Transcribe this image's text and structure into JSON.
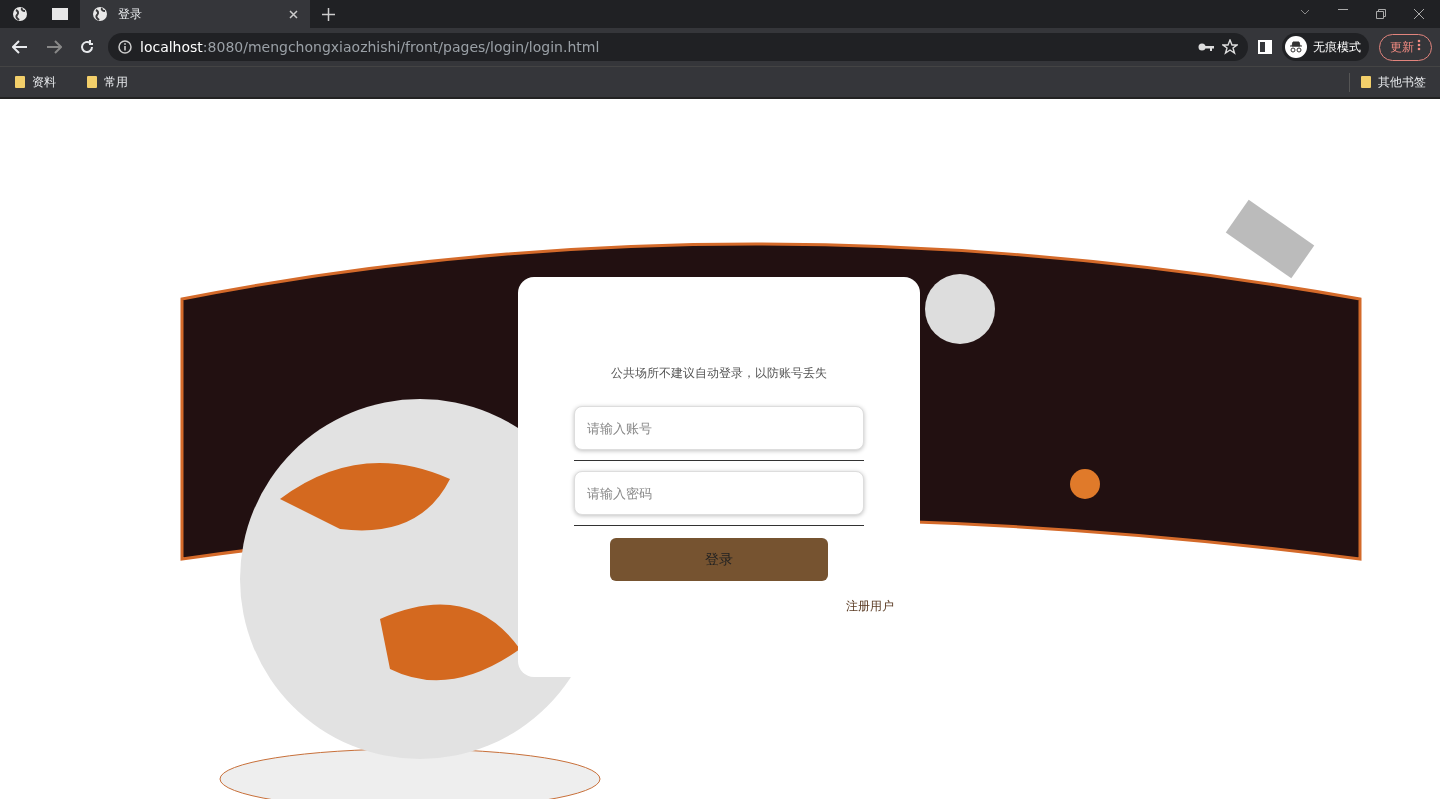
{
  "browser": {
    "tab": {
      "title": "登录"
    },
    "address": {
      "host": "localhost",
      "path": ":8080/mengchongxiaozhishi/front/pages/login/login.html"
    },
    "profile": "无痕模式",
    "update_button": "更新",
    "bookmarks": [
      "资料",
      "常用"
    ],
    "other_bookmarks": "其他书签"
  },
  "login": {
    "hint": "公共场所不建议自动登录，以防账号丢失",
    "fields": [
      {
        "placeholder": "请输入账号"
      },
      {
        "placeholder": "请输入密码"
      }
    ],
    "submit": "登录",
    "register_link": "注册用户"
  }
}
